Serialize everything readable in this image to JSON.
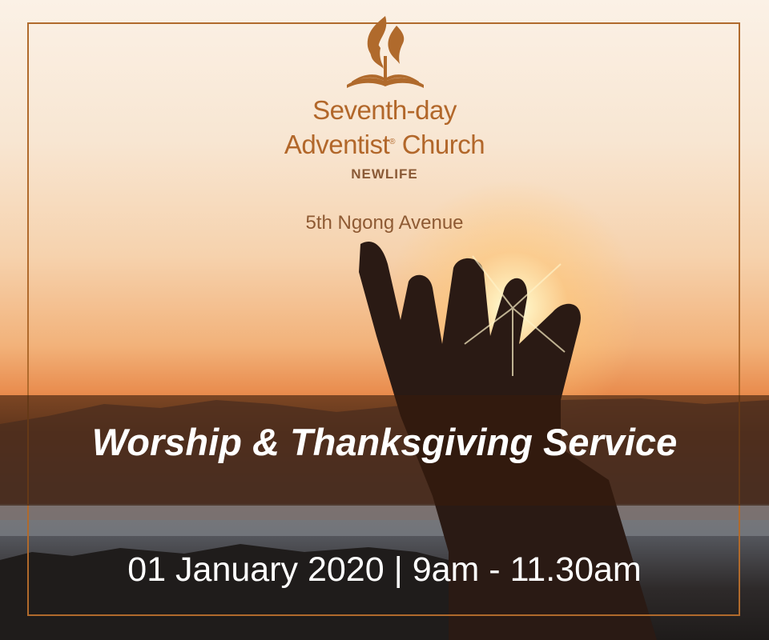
{
  "logo": {
    "name": "church-flame-bible-logo",
    "color": "#b06a2c"
  },
  "church": {
    "name_line1": "Seventh-day",
    "name_line2_main": "Adventist",
    "name_line2_mark": "®",
    "name_line2_end": " Church",
    "branch": "NEWLIFE"
  },
  "address": "5th Ngong Avenue",
  "event": {
    "title": "Worship & Thanksgiving Service",
    "date_time": "01 January 2020 | 9am - 11.30am"
  },
  "colors": {
    "accent": "#b06a2c",
    "band": "#371c0c"
  }
}
